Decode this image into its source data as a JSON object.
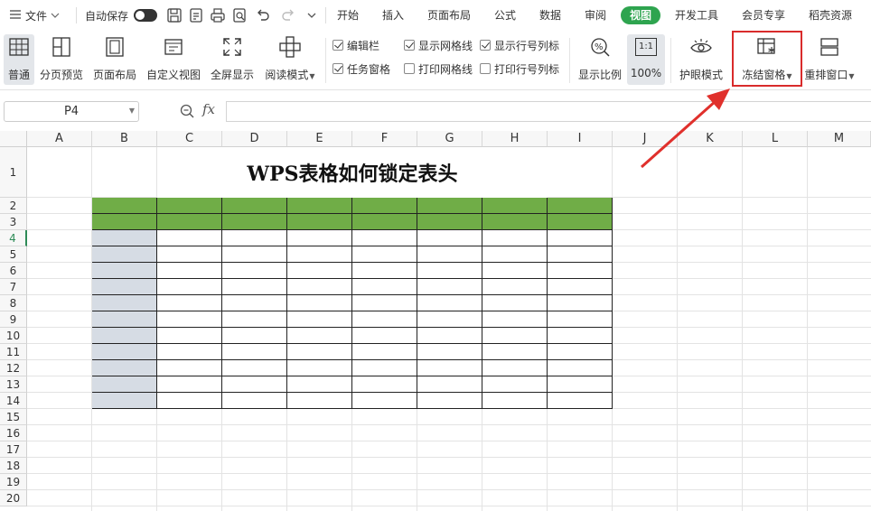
{
  "menu": {
    "file_label": "文件",
    "autosave_label": "自动保存",
    "tabs": [
      {
        "label": "开始"
      },
      {
        "label": "插入"
      },
      {
        "label": "页面布局"
      },
      {
        "label": "公式"
      },
      {
        "label": "数据"
      },
      {
        "label": "审阅"
      },
      {
        "label": "视图",
        "active": true
      },
      {
        "label": "开发工具"
      },
      {
        "label": "会员专享"
      },
      {
        "label": "稻壳资源"
      }
    ]
  },
  "ribbon": {
    "buttons": {
      "normal": "普通",
      "page_break": "分页预览",
      "page_layout": "页面布局",
      "custom_view": "自定义视图",
      "fullscreen": "全屏显示",
      "reading_mode": "阅读模式",
      "zoom": "显示比例",
      "zoom_100": "100%",
      "zoom_100_icon_text": "1:1",
      "eye_protect": "护眼模式",
      "freeze": "冻结窗格",
      "rearrange": "重排窗口"
    },
    "checks": {
      "edit_bar": {
        "label": "编辑栏",
        "checked": true
      },
      "task_pane": {
        "label": "任务窗格",
        "checked": true
      },
      "show_grid": {
        "label": "显示网格线",
        "checked": true
      },
      "print_grid": {
        "label": "打印网格线",
        "checked": false
      },
      "show_headers": {
        "label": "显示行号列标",
        "checked": true
      },
      "print_headers": {
        "label": "打印行号列标",
        "checked": false
      }
    }
  },
  "formula_bar": {
    "cell_ref": "P4",
    "fx_label": "fx",
    "formula": ""
  },
  "sheet": {
    "columns": [
      "A",
      "B",
      "C",
      "D",
      "E",
      "F",
      "G",
      "H",
      "I",
      "J",
      "K",
      "L",
      "M"
    ],
    "rows": [
      "1",
      "2",
      "3",
      "4",
      "5",
      "6",
      "7",
      "8",
      "9",
      "10",
      "11",
      "12",
      "13",
      "14",
      "15",
      "16",
      "17",
      "18",
      "19",
      "20"
    ],
    "active_row": "4",
    "title": "WPS表格如何锁定表头"
  },
  "colors": {
    "accent_green": "#2ea44f",
    "header_fill": "#70ad47",
    "first_col_fill": "#d6dce4",
    "highlight_red": "#d92b2b"
  }
}
